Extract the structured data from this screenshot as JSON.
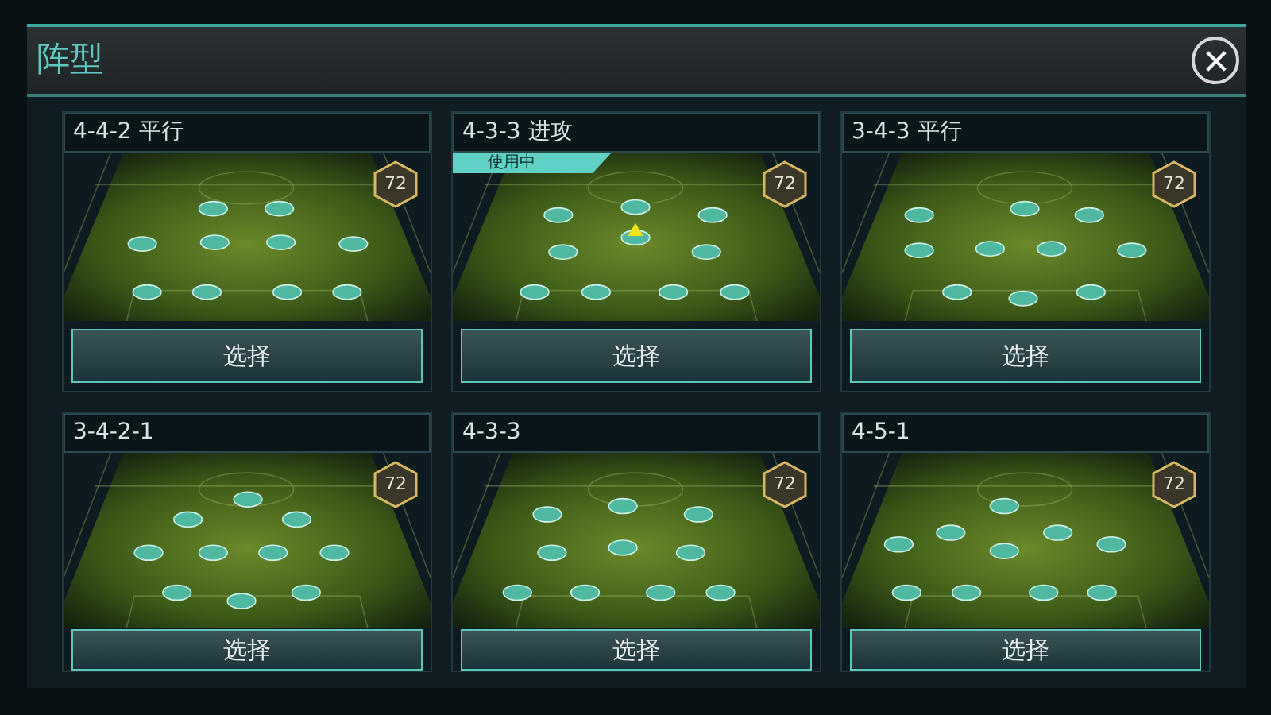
{
  "dialog": {
    "title": "阵型",
    "in_use_label": "使用中"
  },
  "formations": [
    {
      "name": "4-4-2 平行",
      "rating": "72",
      "selected": false,
      "button": "选择"
    },
    {
      "name": "4-3-3 进攻",
      "rating": "72",
      "selected": true,
      "button": "选择"
    },
    {
      "name": "3-4-3 平行",
      "rating": "72",
      "selected": false,
      "button": "选择"
    },
    {
      "name": "3-4-2-1",
      "rating": "72",
      "selected": false,
      "button": "选择"
    },
    {
      "name": "4-3-3",
      "rating": "72",
      "selected": false,
      "button": "选择"
    },
    {
      "name": "4-5-1",
      "rating": "72",
      "selected": false,
      "button": "选择"
    }
  ]
}
